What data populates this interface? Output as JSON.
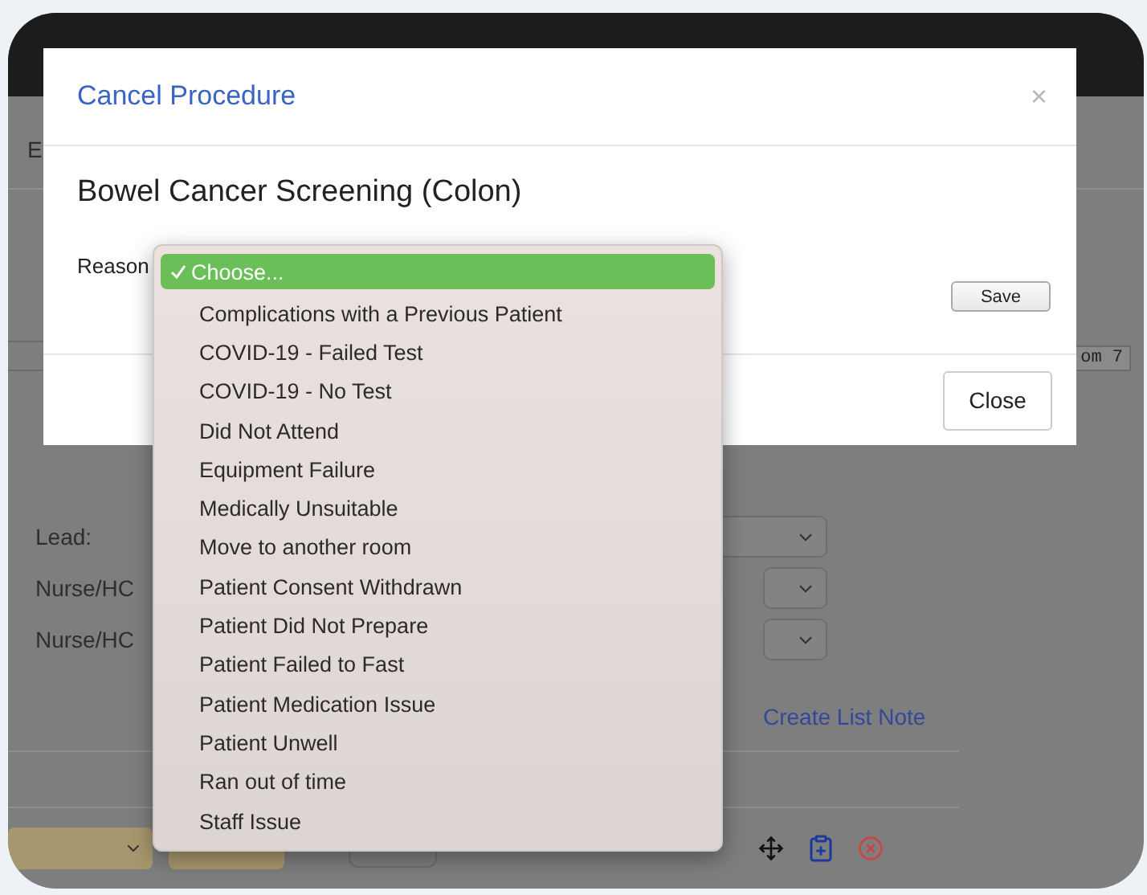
{
  "modal": {
    "title": "Cancel Procedure",
    "close_glyph": "×",
    "procedure": "Bowel Cancer Screening (Colon)",
    "reason_label": "Reason",
    "save": "Save",
    "close": "Close"
  },
  "dropdown": {
    "options": [
      {
        "label": "Choose...",
        "selected": true
      },
      {
        "label": "Complications with a Previous Patient",
        "selected": false
      },
      {
        "label": "COVID-19 - Failed Test",
        "selected": false
      },
      {
        "label": "COVID-19 - No Test",
        "selected": false
      },
      {
        "label": "Did Not Attend",
        "selected": false
      },
      {
        "label": "Equipment Failure",
        "selected": false
      },
      {
        "label": "Medically Unsuitable",
        "selected": false
      },
      {
        "label": "Move to another room",
        "selected": false
      },
      {
        "label": "Patient Consent Withdrawn",
        "selected": false
      },
      {
        "label": "Patient Did Not Prepare",
        "selected": false
      },
      {
        "label": "Patient Failed to Fast",
        "selected": false
      },
      {
        "label": "Patient Medication Issue",
        "selected": false
      },
      {
        "label": "Patient Unwell",
        "selected": false
      },
      {
        "label": "Ran out of time",
        "selected": false
      },
      {
        "label": "Staff Issue",
        "selected": false
      }
    ]
  },
  "background": {
    "tab_letter": "E",
    "room_label": "om 7",
    "staff_fields": [
      {
        "label": "Lead:"
      },
      {
        "label": "Nurse/HC"
      },
      {
        "label": "Nurse/HC"
      }
    ],
    "create_note_link": "Create List Note"
  }
}
